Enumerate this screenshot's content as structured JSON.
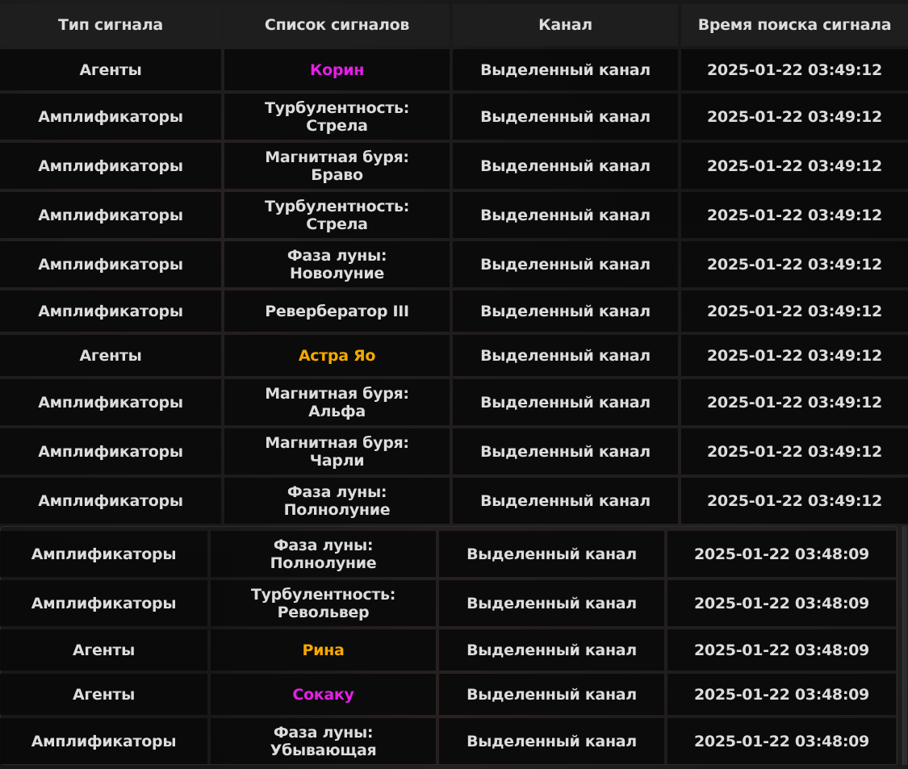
{
  "colors": {
    "purple": "#e51ee8",
    "gold": "#f5a800",
    "default": "#dcdcdc"
  },
  "headers": {
    "type": "Тип сигнала",
    "list": "Список сигналов",
    "channel": "Канал",
    "time": "Время поиска сигнала"
  },
  "top_rows": [
    {
      "type": "Агенты",
      "name": "Корин",
      "rarity": "purple",
      "channel": "Выделенный канал",
      "time": "2025-01-22 03:49:12"
    },
    {
      "type": "Амплификаторы",
      "name": "Турбулентность:\nСтрела",
      "rarity": "default",
      "channel": "Выделенный канал",
      "time": "2025-01-22 03:49:12"
    },
    {
      "type": "Амплификаторы",
      "name": "Магнитная буря:\nБраво",
      "rarity": "default",
      "channel": "Выделенный канал",
      "time": "2025-01-22 03:49:12"
    },
    {
      "type": "Амплификаторы",
      "name": "Турбулентность:\nСтрела",
      "rarity": "default",
      "channel": "Выделенный канал",
      "time": "2025-01-22 03:49:12"
    },
    {
      "type": "Амплификаторы",
      "name": "Фаза луны:\nНоволуние",
      "rarity": "default",
      "channel": "Выделенный канал",
      "time": "2025-01-22 03:49:12"
    },
    {
      "type": "Амплификаторы",
      "name": "Реверберaтор III",
      "rarity": "default",
      "channel": "Выделенный канал",
      "time": "2025-01-22 03:49:12"
    },
    {
      "type": "Агенты",
      "name": "Астра Яо",
      "rarity": "gold",
      "channel": "Выделенный канал",
      "time": "2025-01-22 03:49:12"
    },
    {
      "type": "Амплификаторы",
      "name": "Магнитная буря:\nАльфа",
      "rarity": "default",
      "channel": "Выделенный канал",
      "time": "2025-01-22 03:49:12"
    },
    {
      "type": "Амплификаторы",
      "name": "Магнитная буря:\nЧарли",
      "rarity": "default",
      "channel": "Выделенный канал",
      "time": "2025-01-22 03:49:12"
    },
    {
      "type": "Амплификаторы",
      "name": "Фаза луны:\nПолнолуние",
      "rarity": "default",
      "channel": "Выделенный канал",
      "time": "2025-01-22 03:49:12"
    }
  ],
  "bottom_rows": [
    {
      "type": "Амплификаторы",
      "name": "Фаза луны:\nПолнолуние",
      "rarity": "default",
      "channel": "Выделенный канал",
      "time": "2025-01-22 03:48:09"
    },
    {
      "type": "Амплификаторы",
      "name": "Турбулентность:\nРевольвер",
      "rarity": "default",
      "channel": "Выделенный канал",
      "time": "2025-01-22 03:48:09"
    },
    {
      "type": "Агенты",
      "name": "Рина",
      "rarity": "gold",
      "channel": "Выделенный канал",
      "time": "2025-01-22 03:48:09"
    },
    {
      "type": "Агенты",
      "name": "Сокаку",
      "rarity": "purple",
      "channel": "Выделенный канал",
      "time": "2025-01-22 03:48:09"
    },
    {
      "type": "Амплификаторы",
      "name": "Фаза луны:\nУбывающая",
      "rarity": "default",
      "channel": "Выделенный канал",
      "time": "2025-01-22 03:48:09"
    }
  ]
}
